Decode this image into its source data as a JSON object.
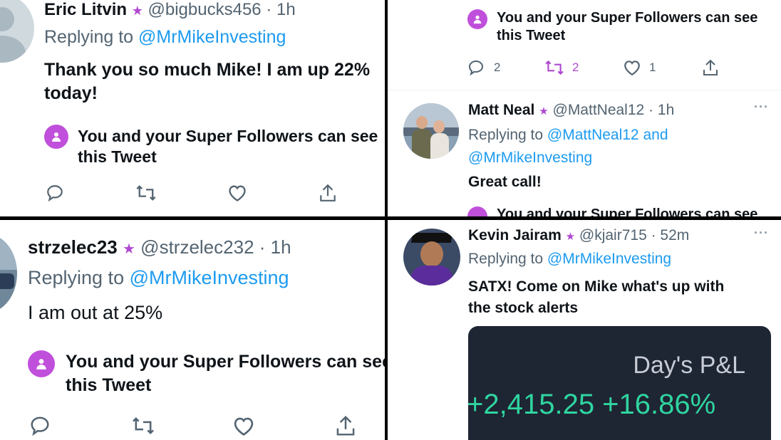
{
  "colors": {
    "brand": "#1d9bf0",
    "super_follow": "#c04fdb",
    "gain": "#2fd5a0",
    "card_bg": "#1e2533"
  },
  "tweets": [
    {
      "name": "Eric Litvin",
      "handle": "@bigbucks456",
      "time": "· 1h",
      "replying_prefix": "Replying to",
      "mention1": "@MrMikeInvesting",
      "text_line1": "Thank you so much Mike! I am up 22%",
      "text_line2": "today!",
      "sf_line1": "You and your Super Followers can see",
      "sf_line2": "this Tweet"
    },
    {
      "sf_line1": "You and your Super Followers can see",
      "sf_line2": "this Tweet",
      "reply_count": "2",
      "retweet_count": "2",
      "like_count": "1"
    },
    {
      "name": "Matt Neal",
      "handle": "@MattNeal12",
      "time": "· 1h",
      "replying_prefix": "Replying to",
      "mention1": "@MattNeal12",
      "and": "and",
      "mention2": "@MrMikeInvesting",
      "text_line1": "Great call!",
      "sf_line1": "You and your Super Followers can see"
    },
    {
      "name": "strzelec23",
      "handle": "@strzelec232",
      "time": "· 1h",
      "replying_prefix": "Replying to",
      "mention1": "@MrMikeInvesting",
      "text_line1": "I am out at 25%",
      "sf_line1": "You and your Super Followers can see",
      "sf_line2": "this Tweet"
    },
    {
      "name": "Kevin Jairam",
      "handle": "@kjair715",
      "time": "· 52m",
      "replying_prefix": "Replying to",
      "mention1": "@MrMikeInvesting",
      "text_line1": "SATX! Come on Mike what's up with",
      "text_line2": "the stock alerts",
      "card_title": "Day's P&L",
      "card_value": "+2,415.25 +16.86%"
    }
  ]
}
